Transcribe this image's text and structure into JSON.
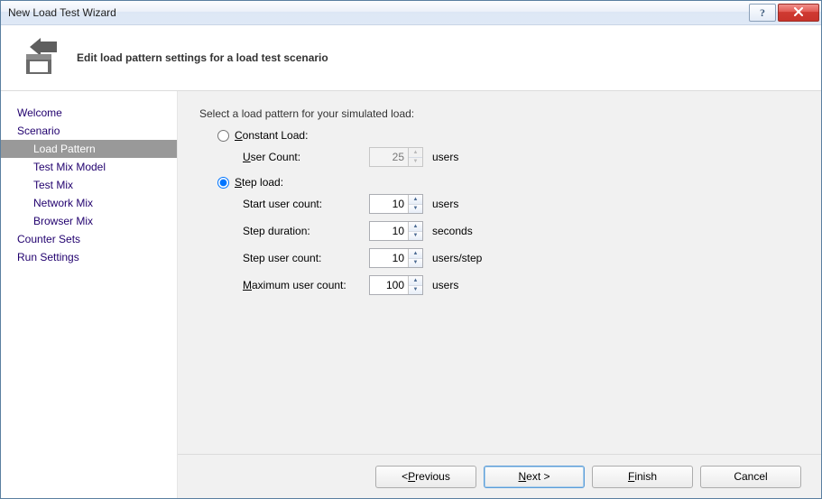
{
  "window": {
    "title": "New Load Test Wizard"
  },
  "header": {
    "text": "Edit load pattern settings for a load test scenario"
  },
  "nav": {
    "welcome": "Welcome",
    "scenario": "Scenario",
    "load_pattern": "Load Pattern",
    "test_mix_model": "Test Mix Model",
    "test_mix": "Test Mix",
    "network_mix": "Network Mix",
    "browser_mix": "Browser Mix",
    "counter_sets": "Counter Sets",
    "run_settings": "Run Settings"
  },
  "content": {
    "prompt": "Select a load pattern for your simulated load:",
    "constant": {
      "label_pre": "",
      "label_access": "C",
      "label_post": "onstant Load:",
      "user_count_label_access": "U",
      "user_count_label_post": "ser Count:",
      "user_count_value": "25",
      "user_count_unit": "users"
    },
    "step": {
      "label_access": "S",
      "label_post": "tep load:",
      "start_label": "Start user count:",
      "start_value": "10",
      "start_unit": "users",
      "duration_label": "Step duration:",
      "duration_value": "10",
      "duration_unit": "seconds",
      "step_user_label": "Step user count:",
      "step_user_value": "10",
      "step_user_unit": "users/step",
      "max_label_access": "M",
      "max_label_post": "aximum user count:",
      "max_value": "100",
      "max_unit": "users"
    }
  },
  "footer": {
    "previous_pre": "< ",
    "previous_access": "P",
    "previous_post": "revious",
    "next_access": "N",
    "next_post": "ext >",
    "finish_access": "F",
    "finish_post": "inish",
    "cancel": "Cancel"
  }
}
